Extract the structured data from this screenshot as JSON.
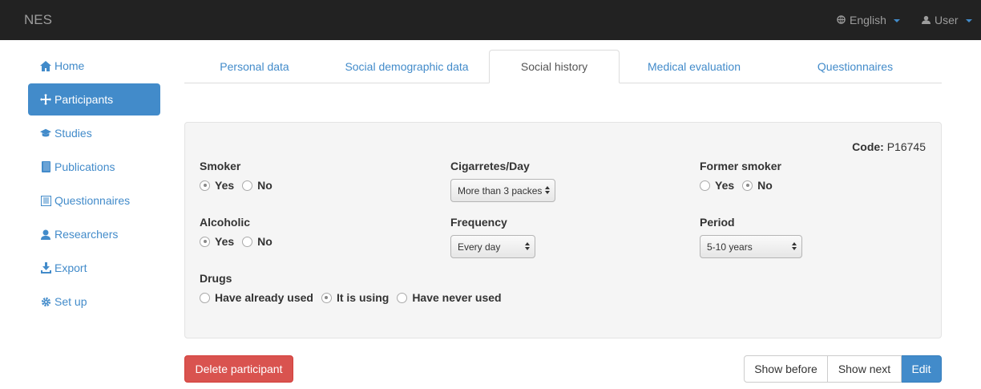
{
  "navbar": {
    "brand": "NES",
    "language": "English",
    "user": "User",
    "language_icon": "globe-icon",
    "user_icon": "user-icon"
  },
  "sidebar": {
    "items": [
      {
        "label": "Home",
        "icon": "home-icon"
      },
      {
        "label": "Participants",
        "icon": "move-icon",
        "active": true
      },
      {
        "label": "Studies",
        "icon": "graduation-cap-icon"
      },
      {
        "label": "Publications",
        "icon": "book-icon"
      },
      {
        "label": "Questionnaires",
        "icon": "list-icon"
      },
      {
        "label": "Researchers",
        "icon": "user-icon"
      },
      {
        "label": "Export",
        "icon": "export-icon"
      },
      {
        "label": "Set up",
        "icon": "cog-icon"
      }
    ]
  },
  "tabs": [
    {
      "label": "Personal data"
    },
    {
      "label": "Social demographic data"
    },
    {
      "label": "Social history",
      "active": true
    },
    {
      "label": "Medical evaluation"
    },
    {
      "label": "Questionnaires"
    }
  ],
  "form": {
    "code_label": "Code:",
    "code_value": "P16745",
    "smoker": {
      "label": "Smoker",
      "yes": "Yes",
      "no": "No",
      "selected": "Yes"
    },
    "cigarettes": {
      "label": "Cigarretes/Day",
      "value": "More than 3 packes"
    },
    "former_smoker": {
      "label": "Former smoker",
      "yes": "Yes",
      "no": "No",
      "selected": "No"
    },
    "alcoholic": {
      "label": "Alcoholic",
      "yes": "Yes",
      "no": "No",
      "selected": "Yes"
    },
    "frequency": {
      "label": "Frequency",
      "value": "Every day"
    },
    "period": {
      "label": "Period",
      "value": "5-10 years"
    },
    "drugs": {
      "label": "Drugs",
      "options": [
        "Have already used",
        "It is using",
        "Have never used"
      ],
      "selected": "It is using"
    }
  },
  "buttons": {
    "delete": "Delete participant",
    "show_before": "Show before",
    "show_next": "Show next",
    "edit": "Edit"
  },
  "colors": {
    "primary": "#428bca",
    "danger": "#d9534f",
    "navbar": "#222222"
  }
}
